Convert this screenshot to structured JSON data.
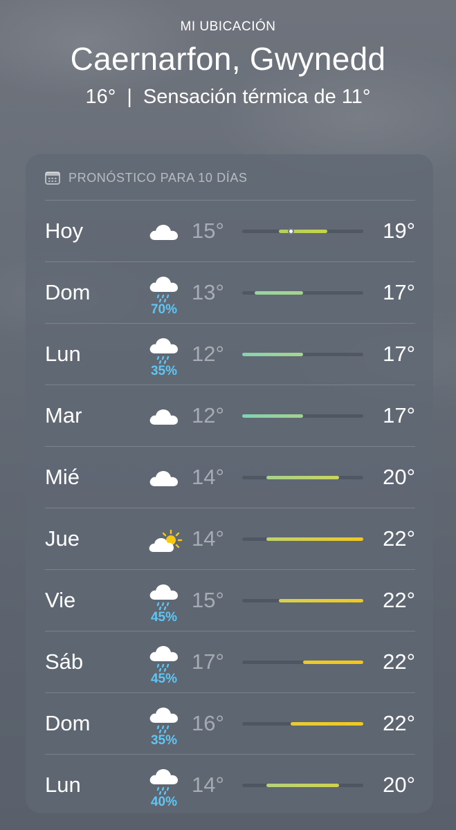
{
  "header": {
    "location_label": "MI UBICACIÓN",
    "city": "Caernarfon, Gwynedd",
    "current_temp": "16°",
    "separator": "|",
    "feels_like": "Sensación térmica de 11°"
  },
  "forecast": {
    "title": "PRONÓSTICO PARA 10 DÍAS",
    "range_min": 12,
    "range_max": 22,
    "days": [
      {
        "day": "Hoy",
        "icon": "cloud-icon",
        "precip": "",
        "low": "15°",
        "high": "19°",
        "low_val": 15,
        "high_val": 19,
        "current_val": 16,
        "color_from": "#b4cf62",
        "color_to": "#c6d445"
      },
      {
        "day": "Dom",
        "icon": "rain-cloud-icon",
        "precip": "70%",
        "low": "13°",
        "high": "17°",
        "low_val": 13,
        "high_val": 17,
        "color_from": "#98d3a2",
        "color_to": "#a6d48a"
      },
      {
        "day": "Lun",
        "icon": "rain-cloud-icon",
        "precip": "35%",
        "low": "12°",
        "high": "17°",
        "low_val": 12,
        "high_val": 17,
        "color_from": "#86d3b0",
        "color_to": "#a8d58c"
      },
      {
        "day": "Mar",
        "icon": "cloud-icon",
        "precip": "",
        "low": "12°",
        "high": "17°",
        "low_val": 12,
        "high_val": 17,
        "color_from": "#7fd3b2",
        "color_to": "#a4d38e"
      },
      {
        "day": "Mié",
        "icon": "cloud-icon",
        "precip": "",
        "low": "14°",
        "high": "20°",
        "low_val": 14,
        "high_val": 20,
        "color_from": "#a6d28c",
        "color_to": "#c9d45e"
      },
      {
        "day": "Jue",
        "icon": "partly-cloudy-icon",
        "precip": "",
        "low": "14°",
        "high": "22°",
        "low_val": 14,
        "high_val": 22,
        "color_from": "#c0d36c",
        "color_to": "#f2c81e"
      },
      {
        "day": "Vie",
        "icon": "rain-cloud-icon",
        "precip": "45%",
        "low": "15°",
        "high": "22°",
        "low_val": 15,
        "high_val": 22,
        "color_from": "#d7d052",
        "color_to": "#f2c81e"
      },
      {
        "day": "Sáb",
        "icon": "rain-cloud-icon",
        "precip": "45%",
        "low": "17°",
        "high": "22°",
        "low_val": 17,
        "high_val": 22,
        "color_from": "#ecc92c",
        "color_to": "#f5c515"
      },
      {
        "day": "Dom",
        "icon": "rain-cloud-icon",
        "precip": "35%",
        "low": "16°",
        "high": "22°",
        "low_val": 16,
        "high_val": 22,
        "color_from": "#e4cc3a",
        "color_to": "#f2c81e"
      },
      {
        "day": "Lun",
        "icon": "rain-cloud-icon",
        "precip": "40%",
        "low": "14°",
        "high": "20°",
        "low_val": 14,
        "high_val": 20,
        "color_from": "#b4d27c",
        "color_to": "#cfd24e"
      }
    ]
  }
}
